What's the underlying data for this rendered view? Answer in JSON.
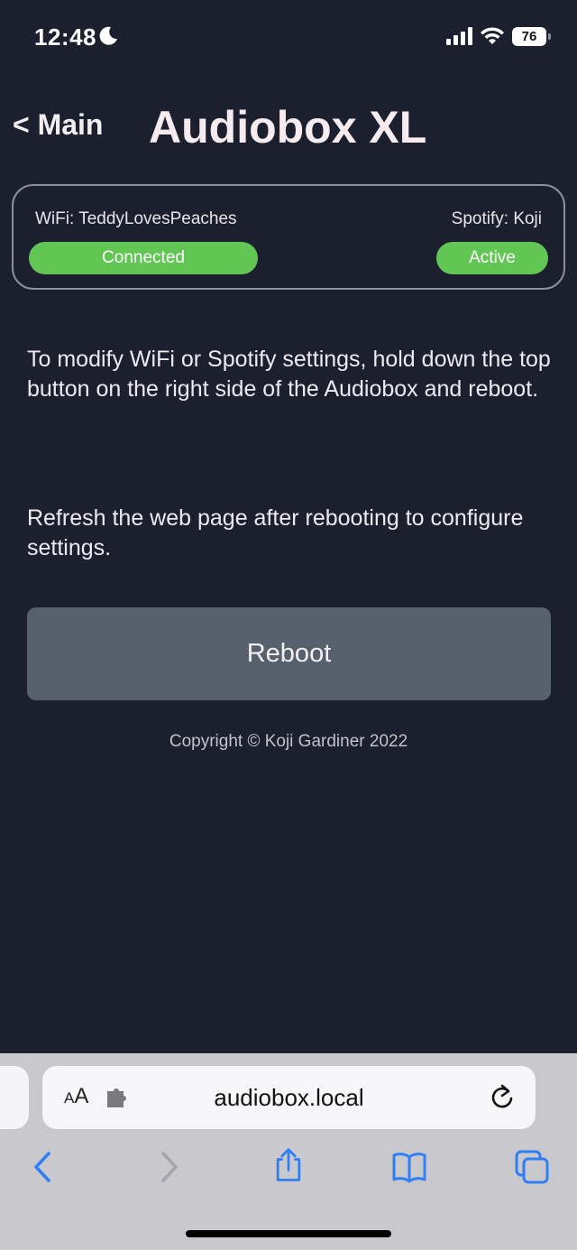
{
  "status_bar": {
    "time": "12:48",
    "battery": "76"
  },
  "header": {
    "back_label": "< Main",
    "title": "Audiobox XL"
  },
  "status_card": {
    "wifi_label": "WiFi: TeddyLovesPeaches",
    "wifi_status": "Connected",
    "spotify_label": "Spotify: Koji",
    "spotify_status": "Active"
  },
  "info": {
    "paragraph_1": "To modify WiFi or Spotify settings, hold down the top button on the right side of the Audiobox and reboot.",
    "paragraph_2": "Refresh the web page after rebooting to configure settings."
  },
  "actions": {
    "reboot_label": "Reboot"
  },
  "footer": {
    "copyright": "Copyright © Koji Gardiner 2022"
  },
  "browser": {
    "aa_small": "A",
    "aa_large": "A",
    "url": "audiobox.local"
  },
  "colors": {
    "background": "#1c1f2e",
    "status_green": "#62c655",
    "button_gray": "#57616d",
    "ios_blue": "#2f7ef6"
  },
  "icons": [
    "moon-icon",
    "cellular-signal-icon",
    "wifi-icon",
    "battery-icon",
    "extension-icon",
    "reload-icon",
    "back-arrow-icon",
    "forward-arrow-icon",
    "share-icon",
    "bookmarks-icon",
    "tabs-icon"
  ]
}
